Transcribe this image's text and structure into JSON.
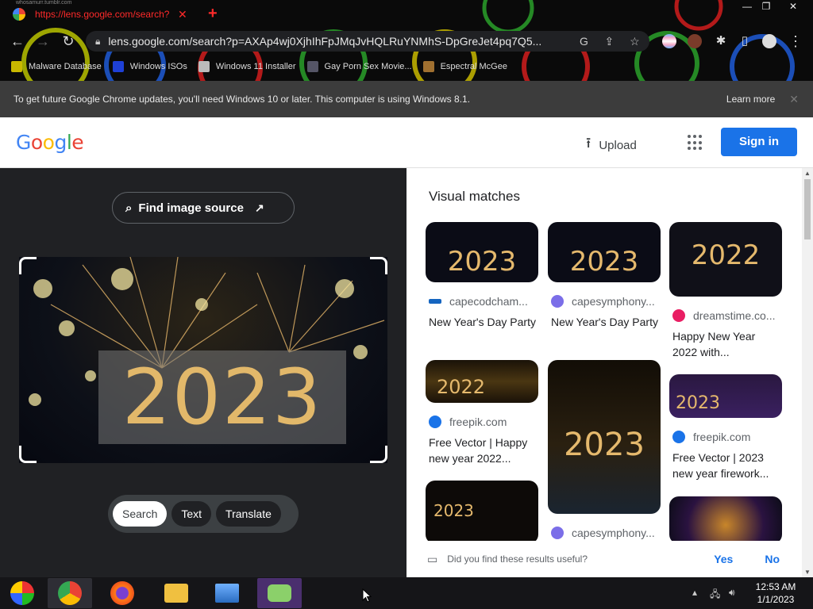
{
  "browser": {
    "window_caption": "whosamurr.tumblr.com",
    "tab_title": "https://lens.google.com/search?p",
    "url": "lens.google.com/search?p=AXAp4wj0XjhIhFpJMqJvHQLRuYNMhS-DpGreJet4pq7Q5...",
    "bookmarks": [
      {
        "label": "Malware Database"
      },
      {
        "label": "Windows ISOs"
      },
      {
        "label": "Windows 11 Installer"
      },
      {
        "label": "Gay Porn Sex Movie..."
      },
      {
        "label": "Espectral McGee"
      }
    ],
    "infobar": {
      "message": "To get future Google Chrome updates, you'll need Windows 10 or later. This computer is using Windows 8.1.",
      "learn_more": "Learn more"
    }
  },
  "header": {
    "logo": "Google",
    "upload_label": "Upload",
    "signin_label": "Sign in"
  },
  "left": {
    "find_source_label": "Find image source",
    "image_text": "2023",
    "modes": [
      "Search",
      "Text",
      "Translate"
    ]
  },
  "right": {
    "title": "Visual matches",
    "cards": [
      {
        "image_text": "2023",
        "source": "capecodcham...",
        "caption": "New Year's Day Party",
        "source_color": "#1565c0"
      },
      {
        "image_text": "2023",
        "source": "capesymphony...",
        "caption": "New Year's Day Party",
        "source_color": "#7b6ee8"
      },
      {
        "image_text": "2022",
        "source": "dreamstime.co...",
        "caption": "Happy New Year 2022 with...",
        "source_color": "#e91e63"
      },
      {
        "image_text": "2022",
        "source": "freepik.com",
        "caption": "Free Vector | Happy new year 2022...",
        "source_color": "#1a73e8"
      },
      {
        "image_text": "2023",
        "source": "capesymphony...",
        "caption": "",
        "source_color": "#7b6ee8"
      },
      {
        "image_text": "2023",
        "source": "freepik.com",
        "caption": "Free Vector | 2023 new year firework...",
        "source_color": "#1a73e8"
      },
      {
        "image_text": "2023",
        "source": "",
        "caption": ""
      },
      {
        "image_text": "",
        "source": "",
        "caption": ""
      }
    ],
    "feedback_question": "Did you find these results useful?",
    "yes": "Yes",
    "no": "No"
  },
  "taskbar": {
    "time": "12:53 AM",
    "date": "1/1/2023"
  }
}
